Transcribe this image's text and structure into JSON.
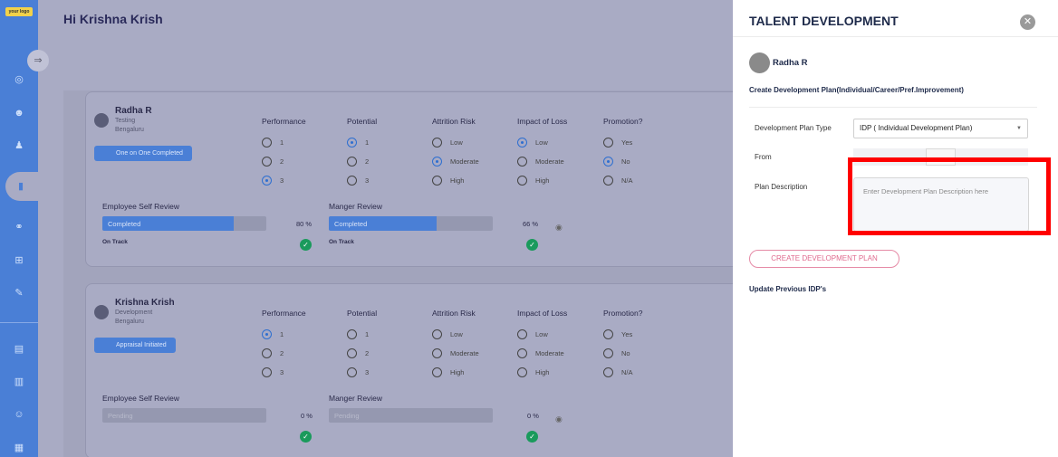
{
  "sidebar": {
    "logo_text": "your logo",
    "icons": [
      "target-icon",
      "team-icon",
      "person-tree-icon",
      "book-icon",
      "handshake-icon",
      "hierarchy-icon",
      "edit-doc-icon",
      "chart-icon",
      "book2-icon",
      "users-icon",
      "report-icon"
    ]
  },
  "header": {
    "greeting": "Hi Krishna Krish"
  },
  "columns": {
    "performance": "Performance",
    "potential": "Potential",
    "attrition": "Attrition Risk",
    "impact": "Impact of Loss",
    "promotion": "Promotion?"
  },
  "options": {
    "performance": [
      "1",
      "2",
      "3"
    ],
    "potential": [
      "1",
      "2",
      "3"
    ],
    "attrition": [
      "Low",
      "Moderate",
      "High"
    ],
    "impact": [
      "Low",
      "Moderate",
      "High"
    ],
    "promotion": [
      "Yes",
      "No",
      "N/A"
    ]
  },
  "review_labels": {
    "self": "Employee Self Review",
    "manager": "Manger Review"
  },
  "employees": [
    {
      "name": "Radha R",
      "dept": "Testing",
      "location": "Bengaluru",
      "status": "One on One Completed",
      "selected": {
        "performance": 2,
        "potential": 0,
        "attrition": 1,
        "impact": 0,
        "promotion": 1
      },
      "self_review": {
        "label": "Completed",
        "percent": "80 %",
        "fill": 0.8,
        "track": "On Track"
      },
      "manager_review": {
        "label": "Completed",
        "percent": "66 %",
        "fill": 0.66,
        "track": "On Track"
      }
    },
    {
      "name": "Krishna Krish",
      "dept": "Development",
      "location": "Bengaluru",
      "status": "Appraisal Initiated",
      "selected": {
        "performance": 0
      },
      "self_review": {
        "label": "Pending",
        "percent": "0 %",
        "fill": 0,
        "track": ""
      },
      "manager_review": {
        "label": "Pending",
        "percent": "0 %",
        "fill": 0,
        "track": ""
      }
    }
  ],
  "panel": {
    "title": "TALENT DEVELOPMENT",
    "employee_name": "Radha R",
    "subtitle": "Create Development Plan(Individual/Career/Pref.Improvement)",
    "plan_type_label": "Development Plan Type",
    "plan_type_value": "IDP ( Individual Development Plan)",
    "from_label": "From",
    "description_label": "Plan Description",
    "description_placeholder": "Enter Development Plan Description here",
    "create_button": "CREATE DEVELOPMENT PLAN",
    "update_link": "Update Previous IDP's"
  },
  "colors": {
    "accent": "#4a7fd6",
    "success": "#1a9a5c",
    "highlight": "#ff0000",
    "create_button": "#e06a8e"
  }
}
